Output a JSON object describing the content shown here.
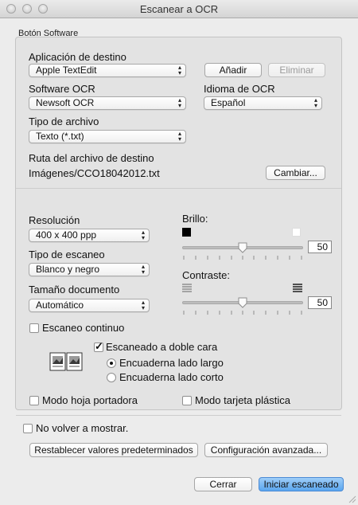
{
  "window": {
    "title": "Escanear a OCR"
  },
  "group": {
    "label": "Botón Software"
  },
  "dest_app": {
    "label": "Aplicación de destino",
    "selected": "Apple TextEdit",
    "add_label": "Añadir",
    "remove_label": "Eliminar"
  },
  "ocr": {
    "software_label": "Software OCR",
    "software_selected": "Newsoft OCR",
    "language_label": "Idioma de OCR",
    "language_selected": "Español"
  },
  "file_type": {
    "label": "Tipo de archivo",
    "selected": "Texto (*.txt)"
  },
  "dest_path": {
    "label": "Ruta del archivo de destino",
    "value": "Imágenes/CCO18042012.txt",
    "change_label": "Cambiar..."
  },
  "scan": {
    "resolution_label": "Resolución",
    "resolution_selected": "400 x 400 ppp",
    "type_label": "Tipo de escaneo",
    "type_selected": "Blanco y negro",
    "size_label": "Tamaño documento",
    "size_selected": "Automático"
  },
  "brightness": {
    "label": "Brillo:",
    "value": "50",
    "level": 0.5
  },
  "contrast": {
    "label": "Contraste:",
    "value": "50",
    "level": 0.5
  },
  "options": {
    "continuous_label": "Escaneo continuo",
    "continuous_checked": false,
    "duplex_label": "Escaneado a doble cara",
    "duplex_checked": true,
    "long_edge_label": "Encuaderna lado largo",
    "short_edge_label": "Encuaderna lado corto",
    "selected_binding": "long",
    "carrier_label": "Modo hoja portadora",
    "carrier_checked": false,
    "plastic_card_label": "Modo tarjeta plástica",
    "plastic_card_checked": false
  },
  "footer": {
    "dont_show_label": "No volver a mostrar.",
    "dont_show_checked": false,
    "reset_label": "Restablecer valores predeterminados",
    "advanced_label": "Configuración avanzada...",
    "cancel_label": "Cerrar",
    "start_label": "Iniciar escaneado"
  },
  "colors": {
    "primary_button": "#5aa6ef",
    "window_bg": "#ececec",
    "group_bg": "#e3e3e3"
  }
}
